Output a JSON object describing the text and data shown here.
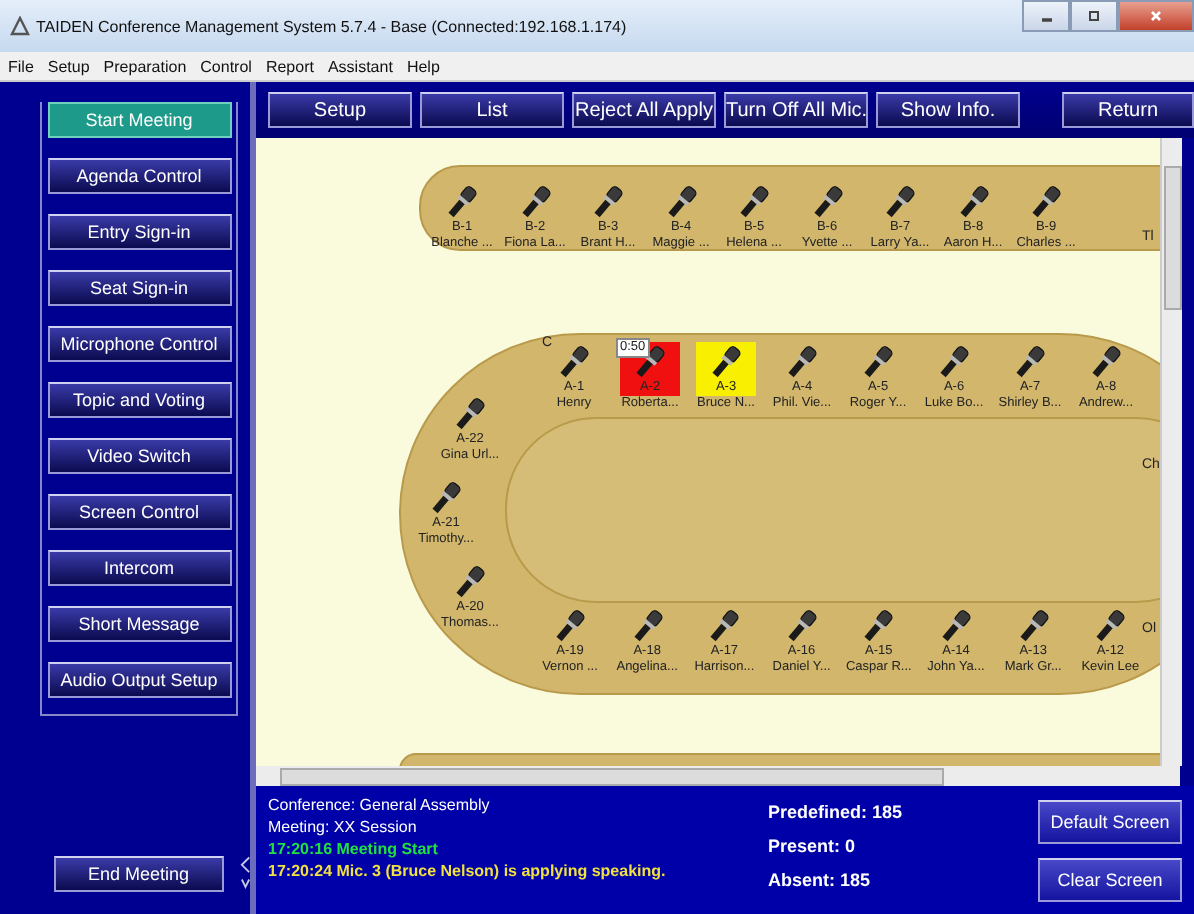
{
  "window": {
    "title": "TAIDEN Conference Management System 5.7.4 - Base (Connected:192.168.1.174)"
  },
  "menu": [
    "File",
    "Setup",
    "Preparation",
    "Control",
    "Report",
    "Assistant",
    "Help"
  ],
  "sidebar": {
    "items": [
      {
        "label": "Start Meeting",
        "selected": true
      },
      {
        "label": "Agenda Control",
        "selected": false
      },
      {
        "label": "Entry Sign-in",
        "selected": false
      },
      {
        "label": "Seat Sign-in",
        "selected": false
      },
      {
        "label": "Microphone Control",
        "selected": false
      },
      {
        "label": "Topic and Voting",
        "selected": false
      },
      {
        "label": "Video Switch",
        "selected": false
      },
      {
        "label": "Screen Control",
        "selected": false
      },
      {
        "label": "Intercom",
        "selected": false
      },
      {
        "label": "Short Message",
        "selected": false
      },
      {
        "label": "Audio Output Setup",
        "selected": false
      }
    ],
    "end_button": "End Meeting"
  },
  "toolbar": [
    "Setup",
    "List",
    "Reject All Apply",
    "Turn Off All Mic.",
    "Show Info.",
    "Return"
  ],
  "seat_groups": [
    {
      "kind": "b_row",
      "cut_label": "Tl",
      "seats": [
        {
          "number": "B-1",
          "name": "Blanche ...",
          "speaking": false,
          "applying": false
        },
        {
          "number": "B-2",
          "name": "Fiona La...",
          "speaking": false,
          "applying": false
        },
        {
          "number": "B-3",
          "name": "Brant H...",
          "speaking": false,
          "applying": false
        },
        {
          "number": "B-4",
          "name": "Maggie ...",
          "speaking": false,
          "applying": false
        },
        {
          "number": "B-5",
          "name": "Helena ...",
          "speaking": false,
          "applying": false
        },
        {
          "number": "B-6",
          "name": "Yvette ...",
          "speaking": false,
          "applying": false
        },
        {
          "number": "B-7",
          "name": "Larry Ya...",
          "speaking": false,
          "applying": false
        },
        {
          "number": "B-8",
          "name": "Aaron H...",
          "speaking": false,
          "applying": false
        },
        {
          "number": "B-9",
          "name": "Charles ...",
          "speaking": false,
          "applying": false
        }
      ]
    },
    {
      "kind": "a_top",
      "cut_label": "Ch",
      "seats": [
        {
          "number": "A-1",
          "name": "Henry",
          "speaking": false,
          "applying": false,
          "tag": "C"
        },
        {
          "number": "A-2",
          "name": "Roberta...",
          "speaking": true,
          "applying": false,
          "timer": "0:50"
        },
        {
          "number": "A-3",
          "name": "Bruce N...",
          "speaking": false,
          "applying": true
        },
        {
          "number": "A-4",
          "name": "Phil. Vie...",
          "speaking": false,
          "applying": false
        },
        {
          "number": "A-5",
          "name": "Roger Y...",
          "speaking": false,
          "applying": false
        },
        {
          "number": "A-6",
          "name": "Luke Bo...",
          "speaking": false,
          "applying": false
        },
        {
          "number": "A-7",
          "name": "Shirley B...",
          "speaking": false,
          "applying": false
        },
        {
          "number": "A-8",
          "name": "Andrew...",
          "speaking": false,
          "applying": false
        }
      ]
    },
    {
      "kind": "a_left",
      "seats": [
        {
          "number": "A-22",
          "name": "Gina Url...",
          "speaking": false,
          "applying": false
        },
        {
          "number": "A-21",
          "name": "Timothy...",
          "speaking": false,
          "applying": false
        },
        {
          "number": "A-20",
          "name": "Thomas...",
          "speaking": false,
          "applying": false
        }
      ]
    },
    {
      "kind": "a_bottom",
      "cut_label": "Ol",
      "seats": [
        {
          "number": "A-19",
          "name": "Vernon ...",
          "speaking": false,
          "applying": false
        },
        {
          "number": "A-18",
          "name": "Angelina...",
          "speaking": false,
          "applying": false
        },
        {
          "number": "A-17",
          "name": "Harrison...",
          "speaking": false,
          "applying": false
        },
        {
          "number": "A-16",
          "name": "Daniel Y...",
          "speaking": false,
          "applying": false
        },
        {
          "number": "A-15",
          "name": "Caspar R...",
          "speaking": false,
          "applying": false
        },
        {
          "number": "A-14",
          "name": "John Ya...",
          "speaking": false,
          "applying": false
        },
        {
          "number": "A-13",
          "name": "Mark Gr...",
          "speaking": false,
          "applying": false
        },
        {
          "number": "A-12",
          "name": "Kevin Lee",
          "speaking": false,
          "applying": false
        }
      ]
    }
  ],
  "info": {
    "lines": [
      {
        "kind": "info",
        "text": "Conference: General Assembly"
      },
      {
        "kind": "info",
        "text": "Meeting: XX Session"
      },
      {
        "kind": "event",
        "text": "17:20:16 Meeting Start"
      },
      {
        "kind": "request",
        "text": "17:20:24 Mic. 3 (Bruce Nelson) is applying speaking."
      }
    ],
    "stats": [
      "Predefined: 185",
      "Present: 0",
      "Absent: 185"
    ],
    "buttons": [
      "Default Screen",
      "Clear Screen"
    ]
  }
}
